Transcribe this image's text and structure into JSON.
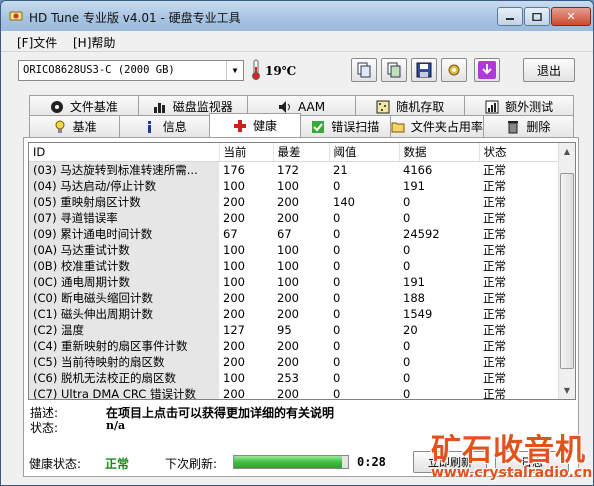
{
  "window": {
    "title": "HD Tune 专业版 v4.01 - 硬盘专业工具"
  },
  "menu": {
    "file": "[F]文件",
    "help": "[H]帮助"
  },
  "toolbar": {
    "drive": "ORICO8628US3-C (2000 GB)",
    "temperature": "19℃",
    "exit_label": "退出"
  },
  "tabs_top": [
    {
      "label": "文件基准",
      "icon": "file-benchmark-icon"
    },
    {
      "label": "磁盘监视器",
      "icon": "disk-monitor-icon"
    },
    {
      "label": "AAM",
      "icon": "speaker-icon"
    },
    {
      "label": "随机存取",
      "icon": "random-access-icon"
    },
    {
      "label": "额外测试",
      "icon": "extra-tests-icon"
    }
  ],
  "tabs_bottom": [
    {
      "label": "基准",
      "icon": "benchmark-icon"
    },
    {
      "label": "信息",
      "icon": "info-icon"
    },
    {
      "label": "健康",
      "icon": "health-cross-icon"
    },
    {
      "label": "错误扫描",
      "icon": "error-scan-icon"
    },
    {
      "label": "文件夹占用率",
      "icon": "folder-usage-icon"
    },
    {
      "label": "删除",
      "icon": "erase-icon"
    }
  ],
  "smart": {
    "columns": [
      "ID",
      "当前",
      "最差",
      "阈值",
      "数据",
      "状态"
    ],
    "rows": [
      [
        "(03) 马达旋转到标准转速所需...",
        "176",
        "172",
        "21",
        "4166",
        "正常"
      ],
      [
        "(04) 马达启动/停止计数",
        "100",
        "100",
        "0",
        "191",
        "正常"
      ],
      [
        "(05) 重映射扇区计数",
        "200",
        "200",
        "140",
        "0",
        "正常"
      ],
      [
        "(07) 寻道错误率",
        "200",
        "200",
        "0",
        "0",
        "正常"
      ],
      [
        "(09) 累计通电时间计数",
        "67",
        "67",
        "0",
        "24592",
        "正常"
      ],
      [
        "(0A) 马达重试计数",
        "100",
        "100",
        "0",
        "0",
        "正常"
      ],
      [
        "(0B) 校准重试计数",
        "100",
        "100",
        "0",
        "0",
        "正常"
      ],
      [
        "(0C) 通电周期计数",
        "100",
        "100",
        "0",
        "191",
        "正常"
      ],
      [
        "(C0) 断电磁头缩回计数",
        "200",
        "200",
        "0",
        "188",
        "正常"
      ],
      [
        "(C1) 磁头伸出周期计数",
        "200",
        "200",
        "0",
        "1549",
        "正常"
      ],
      [
        "(C2) 温度",
        "127",
        "95",
        "0",
        "20",
        "正常"
      ],
      [
        "(C4) 重新映射的扇区事件计数",
        "200",
        "200",
        "0",
        "0",
        "正常"
      ],
      [
        "(C5) 当前待映射的扇区数",
        "200",
        "200",
        "0",
        "0",
        "正常"
      ],
      [
        "(C6) 脱机无法校正的扇区数",
        "100",
        "253",
        "0",
        "0",
        "正常"
      ],
      [
        "(C7) Ultra DMA CRC 错误计数",
        "200",
        "200",
        "0",
        "0",
        "正常"
      ]
    ]
  },
  "details": {
    "desc_label": "描述:",
    "desc_text": "在项目上点击可以获得更加详细的有关说明",
    "status_label": "状态:",
    "status_text": "n/a"
  },
  "footer": {
    "health_label": "健康状态:",
    "health_value": "正常",
    "next_refresh_label": "下次刷新:",
    "refresh_progress": 0.95,
    "time": "0:28",
    "refresh_now": "立即刷新",
    "log": "日志"
  },
  "watermark": {
    "big": "矿石收音机",
    "small": "www.crystalradio.cn"
  },
  "colors": {
    "health_ok": "#1b8a1b",
    "progress": "#3fbf3f",
    "watermark": "#e0531e"
  }
}
